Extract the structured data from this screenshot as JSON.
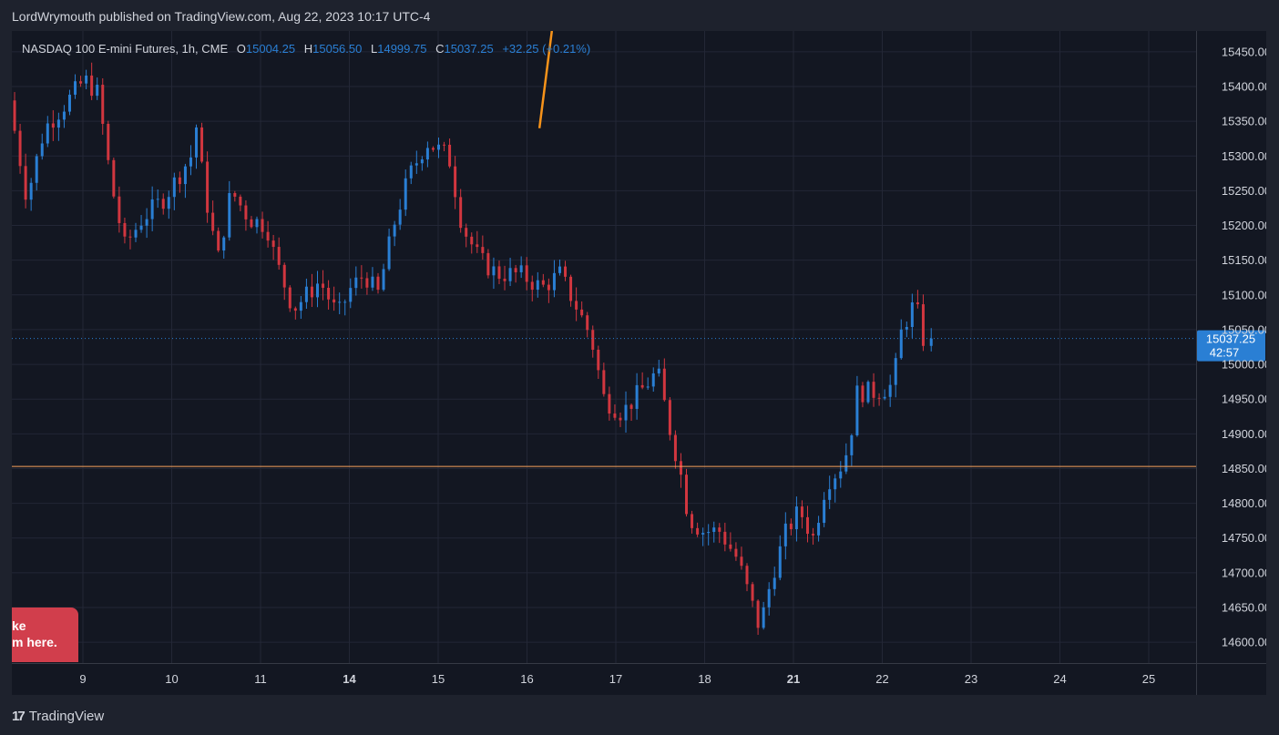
{
  "header": {
    "publisher": "LordWrymouth published on TradingView.com, Aug 22, 2023 10:17 UTC-4"
  },
  "legend": {
    "symbol": "NASDAQ 100 E-mini Futures, 1h, CME",
    "open_label": "O",
    "open": "15004.25",
    "high_label": "H",
    "high": "15056.50",
    "low_label": "L",
    "low": "14999.75",
    "close_label": "C",
    "close": "15037.25",
    "change": "+32.25 (+0.21%)"
  },
  "price_tag": {
    "price": "15037.25",
    "countdown": "42:57"
  },
  "promo": {
    "line1": "ke",
    "line2": "m here."
  },
  "brand": {
    "logo": "17",
    "name": "TradingView"
  },
  "colors": {
    "up": "#2a7fd4",
    "down": "#d1363f",
    "background": "#131722",
    "grid": "#232736",
    "level": "#f7a35c",
    "accent": "#2a7fd4"
  },
  "chart_data": {
    "type": "candlestick",
    "title": "NASDAQ 100 E-mini Futures, 1h, CME",
    "ylim": [
      14570,
      15480
    ],
    "y_ticks": [
      14600,
      14650,
      14700,
      14750,
      14800,
      14850,
      14900,
      14950,
      15000,
      15050,
      15100,
      15150,
      15200,
      15250,
      15300,
      15350,
      15400,
      15450
    ],
    "x_ticks": [
      {
        "label": "9",
        "pos": 0.8,
        "bold": false
      },
      {
        "label": "10",
        "pos": 1.8,
        "bold": false
      },
      {
        "label": "11",
        "pos": 2.8,
        "bold": false
      },
      {
        "label": "14",
        "pos": 3.8,
        "bold": true
      },
      {
        "label": "15",
        "pos": 4.8,
        "bold": false
      },
      {
        "label": "16",
        "pos": 5.8,
        "bold": false
      },
      {
        "label": "17",
        "pos": 6.8,
        "bold": false
      },
      {
        "label": "18",
        "pos": 7.8,
        "bold": false
      },
      {
        "label": "21",
        "pos": 8.8,
        "bold": true
      },
      {
        "label": "22",
        "pos": 9.8,
        "bold": false
      },
      {
        "label": "23",
        "pos": 10.8,
        "bold": false
      },
      {
        "label": "24",
        "pos": 11.8,
        "bold": false
      },
      {
        "label": "25",
        "pos": 12.8,
        "bold": false
      }
    ],
    "horizontal_level": 14853,
    "last_price": 15037.25,
    "trend_line": {
      "from": [
        5.94,
        15340
      ],
      "to": [
        6.08,
        15480
      ]
    },
    "keyframes": [
      [
        0.0,
        15380
      ],
      [
        0.2,
        15240
      ],
      [
        0.4,
        15340
      ],
      [
        0.6,
        15370
      ],
      [
        0.85,
        15410
      ],
      [
        1.0,
        15390
      ],
      [
        1.15,
        15260
      ],
      [
        1.3,
        15170
      ],
      [
        1.5,
        15210
      ],
      [
        1.75,
        15240
      ],
      [
        1.95,
        15280
      ],
      [
        2.05,
        15300
      ],
      [
        2.1,
        15350
      ],
      [
        2.2,
        15250
      ],
      [
        2.35,
        15150
      ],
      [
        2.5,
        15250
      ],
      [
        2.7,
        15210
      ],
      [
        2.9,
        15200
      ],
      [
        3.0,
        15150
      ],
      [
        3.2,
        15080
      ],
      [
        3.5,
        15120
      ],
      [
        3.7,
        15070
      ],
      [
        3.85,
        15110
      ],
      [
        4.0,
        15130
      ],
      [
        4.15,
        15100
      ],
      [
        4.35,
        15210
      ],
      [
        4.5,
        15270
      ],
      [
        4.7,
        15320
      ],
      [
        4.95,
        15300
      ],
      [
        5.1,
        15200
      ],
      [
        5.3,
        15150
      ],
      [
        5.5,
        15130
      ],
      [
        5.75,
        15130
      ],
      [
        6.0,
        15110
      ],
      [
        6.2,
        15130
      ],
      [
        6.4,
        15080
      ],
      [
        6.55,
        15040
      ],
      [
        6.7,
        14950
      ],
      [
        6.9,
        14930
      ],
      [
        7.1,
        14960
      ],
      [
        7.3,
        14990
      ],
      [
        7.45,
        14900
      ],
      [
        7.55,
        14850
      ],
      [
        7.65,
        14780
      ],
      [
        7.8,
        14760
      ],
      [
        8.0,
        14760
      ],
      [
        8.2,
        14720
      ],
      [
        8.35,
        14660
      ],
      [
        8.45,
        14620
      ],
      [
        8.6,
        14700
      ],
      [
        8.75,
        14760
      ],
      [
        8.9,
        14790
      ],
      [
        9.05,
        14750
      ],
      [
        9.2,
        14830
      ],
      [
        9.35,
        14850
      ],
      [
        9.45,
        14880
      ],
      [
        9.55,
        14960
      ],
      [
        9.75,
        14960
      ],
      [
        9.95,
        14970
      ],
      [
        10.05,
        15050
      ],
      [
        10.2,
        15090
      ],
      [
        10.32,
        15020
      ]
    ]
  }
}
